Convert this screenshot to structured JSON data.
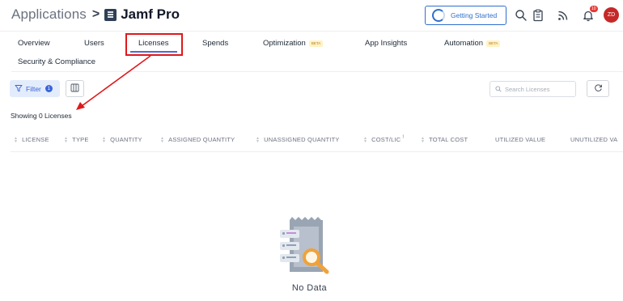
{
  "header": {
    "breadcrumb_root": "Applications",
    "breadcrumb_separator": ">",
    "app_name": "Jamf Pro",
    "getting_started_label": "Getting Started",
    "notification_count": "10",
    "avatar_initials": "ZD"
  },
  "tabs": [
    {
      "label": "Overview"
    },
    {
      "label": "Users"
    },
    {
      "label": "Licenses",
      "active": true
    },
    {
      "label": "Spends"
    },
    {
      "label": "Optimization",
      "badge": "BETA"
    },
    {
      "label": "App Insights"
    },
    {
      "label": "Automation",
      "badge": "BETA"
    },
    {
      "label": "Security & Compliance"
    }
  ],
  "toolbar": {
    "filter_label": "Filter",
    "filter_count": "1",
    "search_placeholder": "Search Licenses"
  },
  "status": {
    "showing_text": "Showing 0 Licenses"
  },
  "table": {
    "columns": [
      {
        "label": "LICENSE",
        "sortable": true
      },
      {
        "label": "TYPE",
        "sortable": true
      },
      {
        "label": "QUANTITY",
        "sortable": true
      },
      {
        "label": "ASSIGNED QUANTITY",
        "sortable": true
      },
      {
        "label": "UNASSIGNED QUANTITY",
        "sortable": true
      },
      {
        "label": "COST/LIC",
        "sortable": true,
        "info_mark": "!"
      },
      {
        "label": "TOTAL COST",
        "sortable": true
      },
      {
        "label": "UTILIZED VALUE",
        "sortable": false
      },
      {
        "label": "UNUTILIZED VA",
        "sortable": false
      }
    ],
    "rows": []
  },
  "empty_state": {
    "message": "No Data"
  },
  "colors": {
    "accent_blue": "#2f6fce",
    "tab_underline": "#4f6bd8",
    "annotation_red": "#e0181b",
    "beta_bg": "#fff3c4",
    "avatar_bg": "#c62828"
  },
  "icons": {
    "filter": "funnel-icon",
    "columns": "columns-icon",
    "search": "search-icon",
    "refresh": "refresh-icon",
    "clipboard": "clipboard-icon",
    "feed": "rss-icon",
    "bell": "bell-icon"
  }
}
